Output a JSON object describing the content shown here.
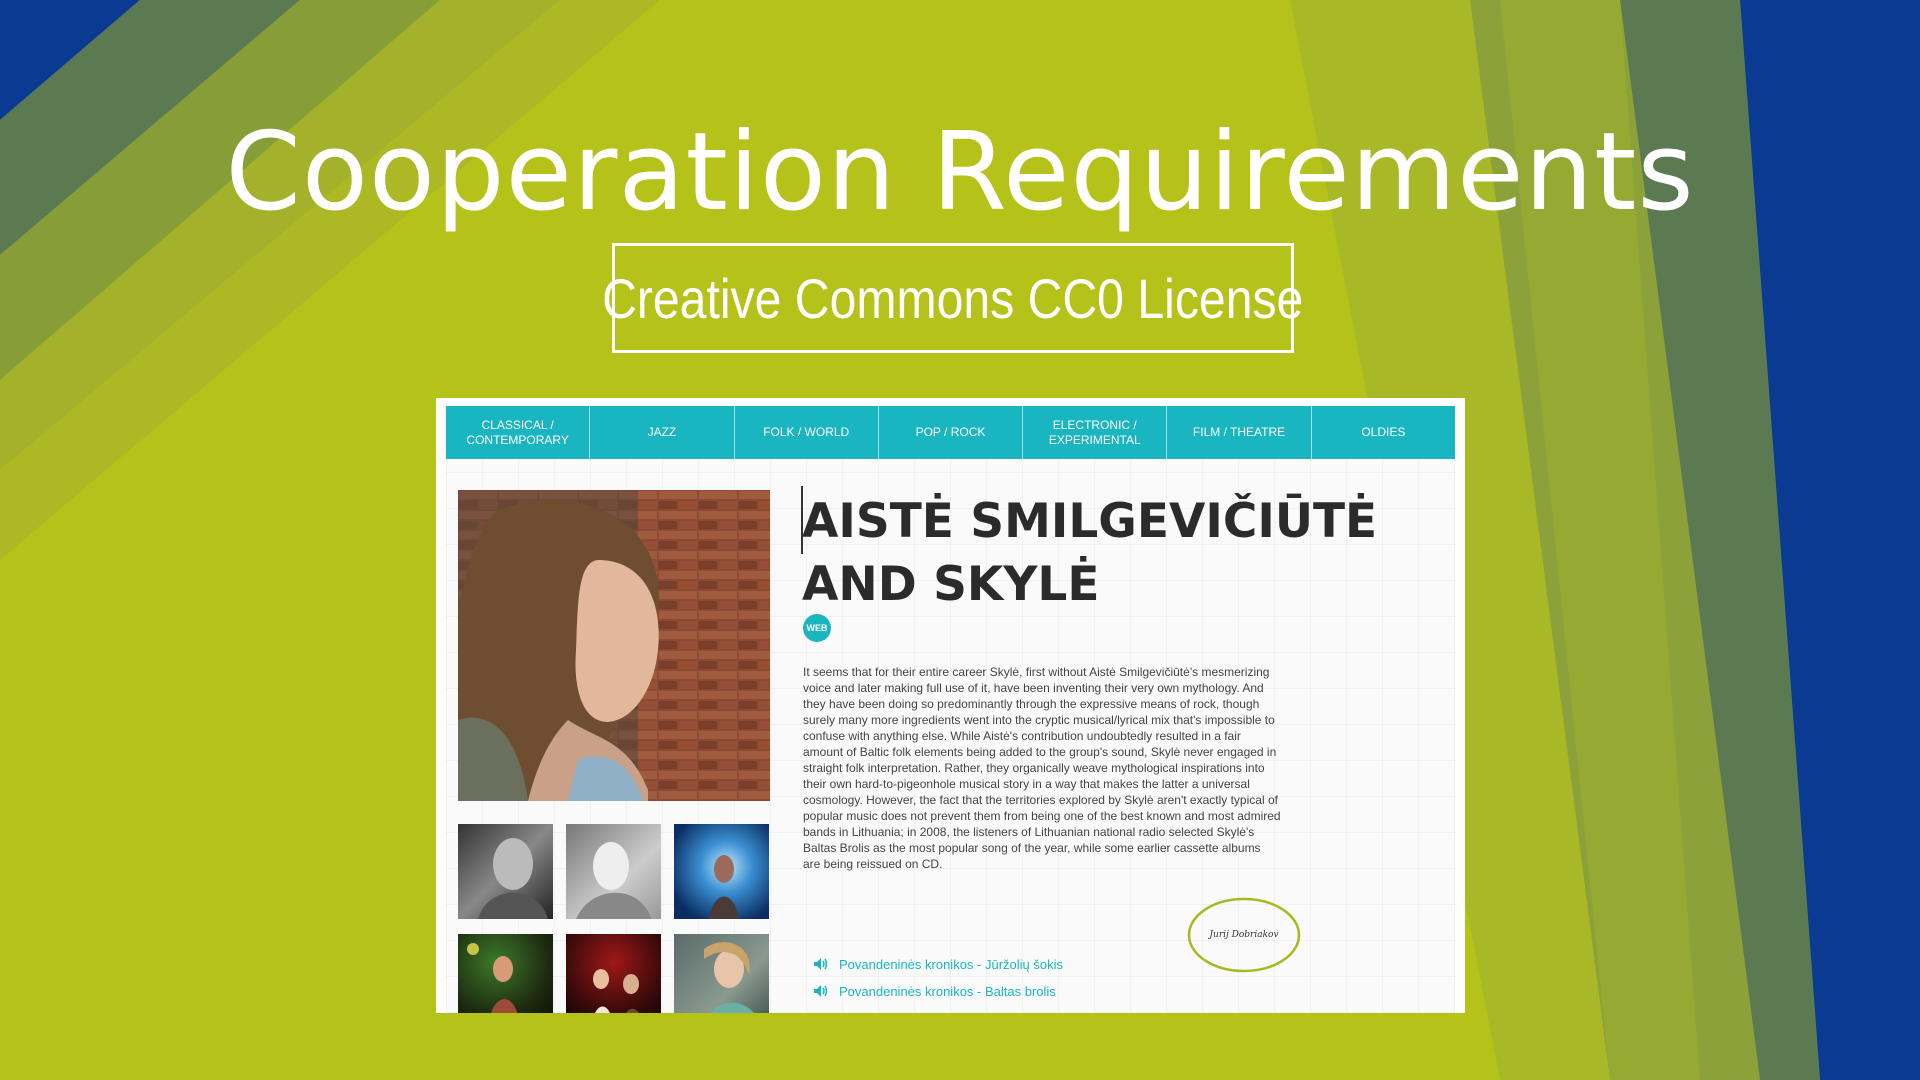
{
  "slide": {
    "title": "Cooperation Requirements",
    "subtitle": "Creative Commons CC0 License"
  },
  "colors": {
    "background_lime": "#b6c21a",
    "stripe_blue": "#0a3a91",
    "stripe_green": "#5b7a52",
    "accent_teal": "#19b6c2"
  },
  "website": {
    "nav": [
      "CLASSICAL /\nCONTEMPORARY",
      "JAZZ",
      "FOLK / WORLD",
      "POP / ROCK",
      "ELECTRONIC /\nEXPERIMENTAL",
      "FILM / THEATRE",
      "OLDIES"
    ],
    "artist_title": "AISTĖ SMILGEVIČIŪTĖ AND SKYLĖ",
    "web_badge": "WEB",
    "bio": "It seems that for their entire career Skylė, first without Aistė Smilgevičiūtė's mesmerizing voice and later making full use of it, have been inventing their very own mythology. And they have been doing so predominantly through the expressive means of rock, though surely many more ingredients went into the cryptic musical/lyrical mix that's impossible to confuse with anything else. While Aistė's contribution undoubtedly resulted in a fair amount of Baltic folk elements being added to the group's sound, Skylė never engaged in straight folk interpretation. Rather, they organically weave mythological inspirations into their own hard-to-pigeonhole musical story in a way that makes the latter a universal cosmology. However, the fact that the territories explored by Skylė aren't exactly typical of popular music does not prevent them from being one of the best known and most admired bands in Lithuania; in 2008, the listeners of Lithuanian national radio selected Skylė's Baltas Brolis as the most popular song of the year, while some earlier cassette albums are being reissued on CD.",
    "signature": "Jurij Dobriakov",
    "tracks": [
      "Povandeninės kronikos - Jūržolių šokis",
      "Povandeninės kronikos - Baltas brolis"
    ]
  }
}
